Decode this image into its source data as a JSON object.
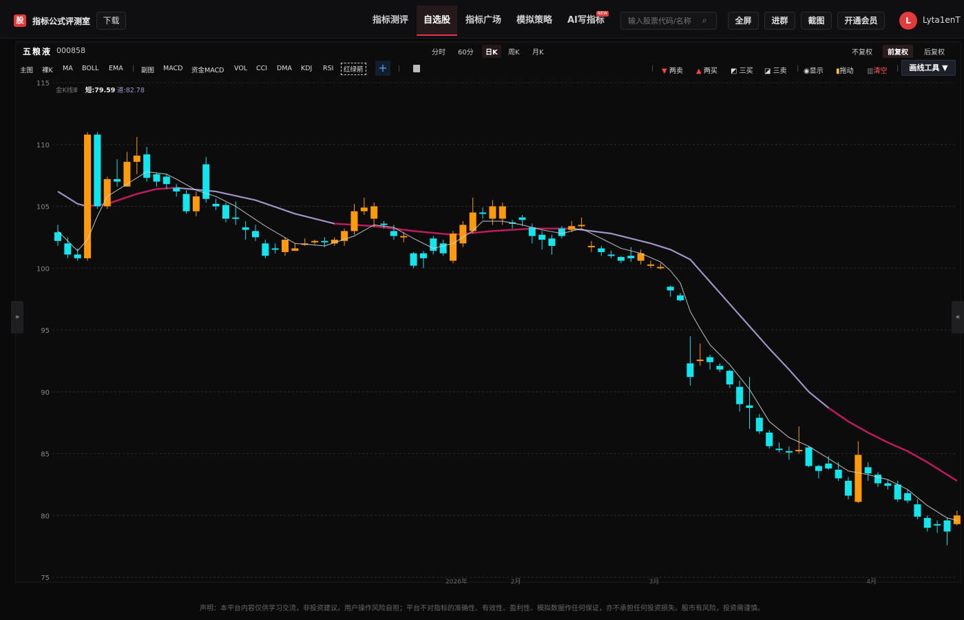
{
  "header": {
    "logo_char": "股",
    "app_name": "指标公式评测室",
    "download": "下载",
    "nav": [
      "指标测评",
      "自选股",
      "指标广场",
      "模拟策略",
      "AI写指标"
    ],
    "new_badge": "NEW",
    "search_placeholder": "输入股票代码/名称",
    "buttons": [
      "全屏",
      "进群",
      "截图",
      "开通会员"
    ],
    "avatar_letter": "L",
    "username": "Lyta1enT"
  },
  "stock": {
    "name": "五粮液",
    "code": "000858"
  },
  "periods": [
    "分时",
    "60分",
    "日K",
    "周K",
    "月K"
  ],
  "adjust": [
    "不复权",
    "前复权",
    "后复权"
  ],
  "indicators": [
    "主图",
    "裸K",
    "MA",
    "BOLL",
    "EMA",
    "副图",
    "MACD",
    "资金MACD",
    "VOL",
    "CCI",
    "DMA",
    "KDJ",
    "RSI",
    "红绿箭"
  ],
  "tools": [
    "两卖",
    "两买",
    "三买",
    "三卖",
    "显示",
    "拖动",
    "清空"
  ],
  "draw_tools": "画线工具 ▼",
  "legend": {
    "name": "金K线Ⅲ",
    "short": "短:79.59",
    "long": "道:82.78"
  },
  "colors": {
    "up": "#ff9a0a",
    "down": "#12e5ee",
    "short_line": "#cfcfcf",
    "long_line": "#a494c8",
    "long_highlight": "#c2185b",
    "accent": "#e23b3b"
  },
  "chart_data": {
    "type": "candlestick",
    "ylim": [
      75,
      115
    ],
    "yticks": [
      75,
      80,
      85,
      90,
      95,
      100,
      105,
      110,
      115
    ],
    "xlabels": [
      "2026年",
      "2月",
      "3月",
      "4月"
    ],
    "candles": [
      [
        102.9,
        102.2,
        103.5,
        101.8
      ],
      [
        102.0,
        101.1,
        102.5,
        100.8
      ],
      [
        101.1,
        100.8,
        101.6,
        100.6
      ],
      [
        100.8,
        110.8,
        111.0,
        100.6
      ],
      [
        110.8,
        105.0,
        111.0,
        104.8
      ],
      [
        105.0,
        107.2,
        107.4,
        104.8
      ],
      [
        107.2,
        107.0,
        108.8,
        106.6
      ],
      [
        106.6,
        108.6,
        109.4,
        106.6
      ],
      [
        108.6,
        109.1,
        110.6,
        107.6
      ],
      [
        109.2,
        107.3,
        109.8,
        107.0
      ],
      [
        107.6,
        107.0,
        107.7,
        106.6
      ],
      [
        107.4,
        106.8,
        107.6,
        106.4
      ],
      [
        106.5,
        106.2,
        106.8,
        105.8
      ],
      [
        106.0,
        104.6,
        106.3,
        104.4
      ],
      [
        104.6,
        105.8,
        106.2,
        104.2
      ],
      [
        108.4,
        105.6,
        109.0,
        105.3
      ],
      [
        105.2,
        105.0,
        105.6,
        104.7
      ],
      [
        105.1,
        104.0,
        105.3,
        103.7
      ],
      [
        104.1,
        104.0,
        105.4,
        103.5
      ],
      [
        103.3,
        103.1,
        103.8,
        102.3
      ],
      [
        103.0,
        102.5,
        103.5,
        102.2
      ],
      [
        102.0,
        101.0,
        102.3,
        100.8
      ],
      [
        101.6,
        101.5,
        102.0,
        101.2
      ],
      [
        101.3,
        102.3,
        102.5,
        101.0
      ],
      [
        101.4,
        101.6,
        102.0,
        101.4
      ],
      [
        101.9,
        102.0,
        102.4,
        101.8
      ],
      [
        102.1,
        102.2,
        102.3,
        101.9
      ],
      [
        102.2,
        102.1,
        102.5,
        101.7
      ],
      [
        102.0,
        102.3,
        102.5,
        101.8
      ],
      [
        102.2,
        103.0,
        103.2,
        101.8
      ],
      [
        103.0,
        104.6,
        105.2,
        102.7
      ],
      [
        104.6,
        104.9,
        105.7,
        104.3
      ],
      [
        104.0,
        105.0,
        105.3,
        103.3
      ],
      [
        103.6,
        103.5,
        103.8,
        103.2
      ],
      [
        103.0,
        102.6,
        103.5,
        102.3
      ],
      [
        102.6,
        102.6,
        102.9,
        102.1
      ],
      [
        101.2,
        100.2,
        101.3,
        100.0
      ],
      [
        101.2,
        100.8,
        101.4,
        100.0
      ],
      [
        102.4,
        101.4,
        102.6,
        101.1
      ],
      [
        102.0,
        101.2,
        102.3,
        101.0
      ],
      [
        100.6,
        102.8,
        103.0,
        100.4
      ],
      [
        102.0,
        103.5,
        103.8,
        101.7
      ],
      [
        103.0,
        104.5,
        105.7,
        102.8
      ],
      [
        104.5,
        104.4,
        104.9,
        104.0
      ],
      [
        104.0,
        105.0,
        105.5,
        103.5
      ],
      [
        104.0,
        105.0,
        105.3,
        103.5
      ],
      [
        103.7,
        103.6,
        103.9,
        103.2
      ],
      [
        104.1,
        103.9,
        104.3,
        103.4
      ],
      [
        103.3,
        102.6,
        103.6,
        102.0
      ],
      [
        102.7,
        102.3,
        103.0,
        101.5
      ],
      [
        102.4,
        101.8,
        102.7,
        101.1
      ],
      [
        103.2,
        102.6,
        103.4,
        102.4
      ],
      [
        103.1,
        103.4,
        103.8,
        102.9
      ],
      [
        103.5,
        103.5,
        104.1,
        103.3
      ],
      [
        101.8,
        101.8,
        102.2,
        101.3
      ],
      [
        101.6,
        101.3,
        101.8,
        101.0
      ],
      [
        101.1,
        101.0,
        101.4,
        100.8
      ],
      [
        100.9,
        100.6,
        101.0,
        100.4
      ],
      [
        101.0,
        100.8,
        101.7,
        100.5
      ],
      [
        100.6,
        101.2,
        101.5,
        100.3
      ],
      [
        100.3,
        100.3,
        100.6,
        100.0
      ],
      [
        100.1,
        100.1,
        100.4,
        99.9
      ],
      [
        98.5,
        98.2,
        98.6,
        97.7
      ],
      [
        97.8,
        97.4,
        98.0,
        97.3
      ],
      [
        92.3,
        91.2,
        94.5,
        90.5
      ],
      [
        92.6,
        92.6,
        93.9,
        92.1
      ],
      [
        92.8,
        92.4,
        93.0,
        91.8
      ],
      [
        92.1,
        91.8,
        92.3,
        91.6
      ],
      [
        91.7,
        90.6,
        91.8,
        90.3
      ],
      [
        90.4,
        89.0,
        90.9,
        88.4
      ],
      [
        88.9,
        88.7,
        91.2,
        87.0
      ],
      [
        87.9,
        86.8,
        88.2,
        86.6
      ],
      [
        86.7,
        85.6,
        86.9,
        85.4
      ],
      [
        85.4,
        85.3,
        85.9,
        85.1
      ],
      [
        85.2,
        85.1,
        85.6,
        84.5
      ],
      [
        85.3,
        85.3,
        87.2,
        85.0
      ],
      [
        85.5,
        84.0,
        85.6,
        83.9
      ],
      [
        84.0,
        83.6,
        84.1,
        83.0
      ],
      [
        84.2,
        83.8,
        84.8,
        83.7
      ],
      [
        83.7,
        83.0,
        84.3,
        82.8
      ],
      [
        82.8,
        81.6,
        83.1,
        81.3
      ],
      [
        81.1,
        84.9,
        86.0,
        81.0
      ],
      [
        83.9,
        83.4,
        84.3,
        82.8
      ],
      [
        83.3,
        82.6,
        83.5,
        82.3
      ],
      [
        82.6,
        82.4,
        82.9,
        82.1
      ],
      [
        82.5,
        81.3,
        82.8,
        81.1
      ],
      [
        81.8,
        81.2,
        82.1,
        81.0
      ],
      [
        80.9,
        79.9,
        81.3,
        79.7
      ],
      [
        79.8,
        79.0,
        80.0,
        78.7
      ],
      [
        79.3,
        79.2,
        79.6,
        78.6
      ],
      [
        79.6,
        78.7,
        79.8,
        77.6
      ],
      [
        79.3,
        80.0,
        80.4,
        79.2
      ]
    ],
    "short_line": [
      [
        0,
        103.0
      ],
      [
        2,
        101.4
      ],
      [
        3,
        102.3
      ],
      [
        4,
        104.2
      ],
      [
        5,
        105.8
      ],
      [
        7,
        106.8
      ],
      [
        9,
        107.8
      ],
      [
        11,
        107.6
      ],
      [
        12,
        107.2
      ],
      [
        14,
        106.3
      ],
      [
        16,
        105.8
      ],
      [
        18,
        105.0
      ],
      [
        21,
        103.4
      ],
      [
        24,
        102.0
      ],
      [
        27,
        101.8
      ],
      [
        30,
        102.6
      ],
      [
        32,
        103.5
      ],
      [
        34,
        103.3
      ],
      [
        36,
        102.4
      ],
      [
        38,
        101.6
      ],
      [
        40,
        102.0
      ],
      [
        42,
        103.0
      ],
      [
        43,
        103.8
      ],
      [
        45,
        103.8
      ],
      [
        47,
        103.5
      ],
      [
        49,
        103.1
      ],
      [
        51,
        102.8
      ],
      [
        53,
        103.2
      ],
      [
        55,
        102.4
      ],
      [
        57,
        101.6
      ],
      [
        59,
        101.2
      ],
      [
        61,
        100.5
      ],
      [
        62,
        99.8
      ],
      [
        63,
        98.8
      ],
      [
        64,
        96.5
      ],
      [
        65,
        95.1
      ],
      [
        66,
        93.8
      ],
      [
        68,
        92.2
      ],
      [
        70,
        90.2
      ],
      [
        72,
        87.6
      ],
      [
        74,
        86.3
      ],
      [
        76,
        85.6
      ],
      [
        78,
        84.6
      ],
      [
        80,
        83.6
      ],
      [
        82,
        83.3
      ],
      [
        84,
        82.9
      ],
      [
        86,
        82.1
      ],
      [
        88,
        80.8
      ],
      [
        90,
        79.8
      ],
      [
        91,
        79.6
      ]
    ],
    "long_line": [
      [
        0,
        106.2
      ],
      [
        2,
        105.2
      ],
      [
        3,
        105.0
      ],
      [
        5,
        105.2
      ],
      [
        8,
        106.0
      ],
      [
        10,
        106.4
      ],
      [
        12,
        106.5
      ],
      [
        16,
        106.2
      ],
      [
        20,
        105.5
      ],
      [
        24,
        104.4
      ],
      [
        28,
        103.6
      ],
      [
        32,
        103.4
      ],
      [
        36,
        103.0
      ],
      [
        40,
        102.7
      ],
      [
        44,
        103.0
      ],
      [
        48,
        103.2
      ],
      [
        52,
        103.2
      ],
      [
        56,
        102.8
      ],
      [
        60,
        102.0
      ],
      [
        62,
        101.5
      ],
      [
        64,
        100.7
      ],
      [
        66,
        98.9
      ],
      [
        68,
        97.1
      ],
      [
        70,
        95.3
      ],
      [
        72,
        93.5
      ],
      [
        74,
        91.8
      ],
      [
        76,
        90.0
      ],
      [
        78,
        88.7
      ],
      [
        80,
        87.6
      ],
      [
        82,
        86.7
      ],
      [
        84,
        85.9
      ],
      [
        86,
        85.2
      ],
      [
        88,
        84.3
      ],
      [
        90,
        83.3
      ],
      [
        91,
        82.8
      ]
    ]
  }
}
